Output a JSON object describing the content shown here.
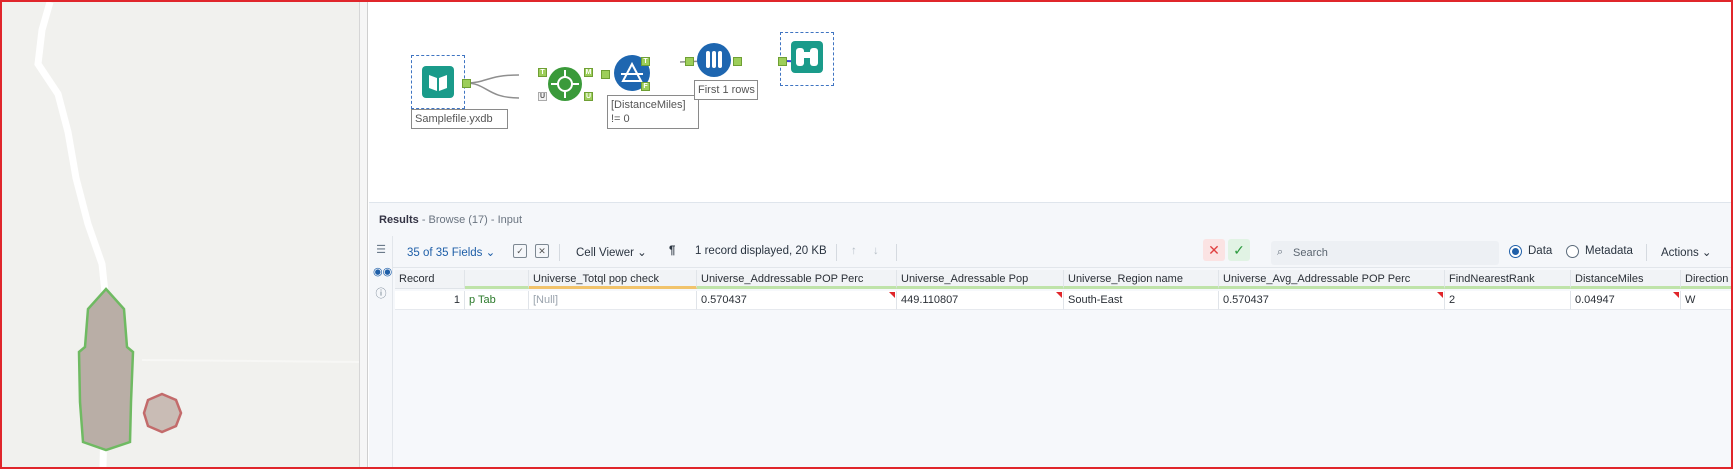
{
  "canvas": {
    "tools": {
      "input_label": "Samplefile.yxdb",
      "filter_label": "[DistanceMiles] != 0",
      "sample_label": "First 1 rows",
      "anchors": {
        "join_t": "T",
        "join_u": "U",
        "join_m": "M",
        "join_u2": "U",
        "filter_t": "T",
        "filter_f": "F"
      }
    }
  },
  "results": {
    "title": "Results",
    "subtitle": "- Browse (17) - Input",
    "toolbar": {
      "fields_label": "35 of 35 Fields",
      "cell_viewer_label": "Cell Viewer",
      "records_info": "1 record displayed, 20 KB",
      "search_placeholder": "Search",
      "data_label": "Data",
      "metadata_label": "Metadata",
      "actions_label": "Actions"
    },
    "columns": [
      "Record",
      "",
      "Universe_Totql pop check",
      "Universe_Addressable POP Perc",
      "Universe_Adressable Pop",
      "Universe_Region name",
      "Universe_Avg_Addressable POP Perc",
      "FindNearestRank",
      "DistanceMiles",
      "Direction"
    ],
    "rows": [
      [
        "1",
        "p Tab",
        "[Null]",
        "0.570437",
        "449.110807",
        "South-East",
        "0.570437",
        "2",
        "0.04947",
        "W"
      ]
    ]
  },
  "colors": {
    "accent": "#1f5fa8",
    "input_tool": "#1a9b8a",
    "join_tool": "#3a9a3a",
    "filter_tool": "#1e66b0",
    "sample_tool": "#1e66b0",
    "browse_tool": "#1a9b8a",
    "anchor": "#9dce5a",
    "border": "#e0262b"
  }
}
